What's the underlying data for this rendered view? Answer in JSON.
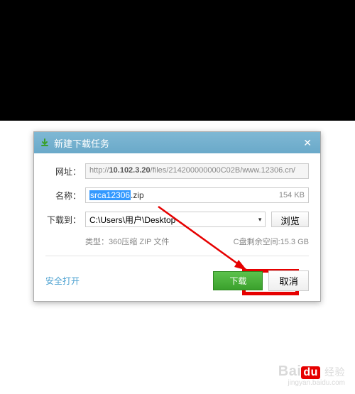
{
  "dialog": {
    "title": "新建下载任务",
    "url_label": "网址：",
    "url_prefix": "http://",
    "url_host": "10.102.3.20",
    "url_path": "/files/214200000000C02B/www.12306.cn/",
    "name_label": "名称：",
    "name_selected": "srca12306",
    "name_ext": ".zip",
    "filesize": "154 KB",
    "saveto_label": "下载到：",
    "saveto_path": "C:\\Users\\用户\\Desktop",
    "browse": "浏览",
    "filetype": "类型：360压缩 ZIP 文件",
    "diskspace": "C盘剩余空间:15.3 GB",
    "safe_open": "安全打开",
    "download": "下载",
    "cancel": "取消"
  },
  "brand": {
    "name": "Bai",
    "du": "du",
    "cn": "经验",
    "url": "jingyan.baidu.com"
  }
}
